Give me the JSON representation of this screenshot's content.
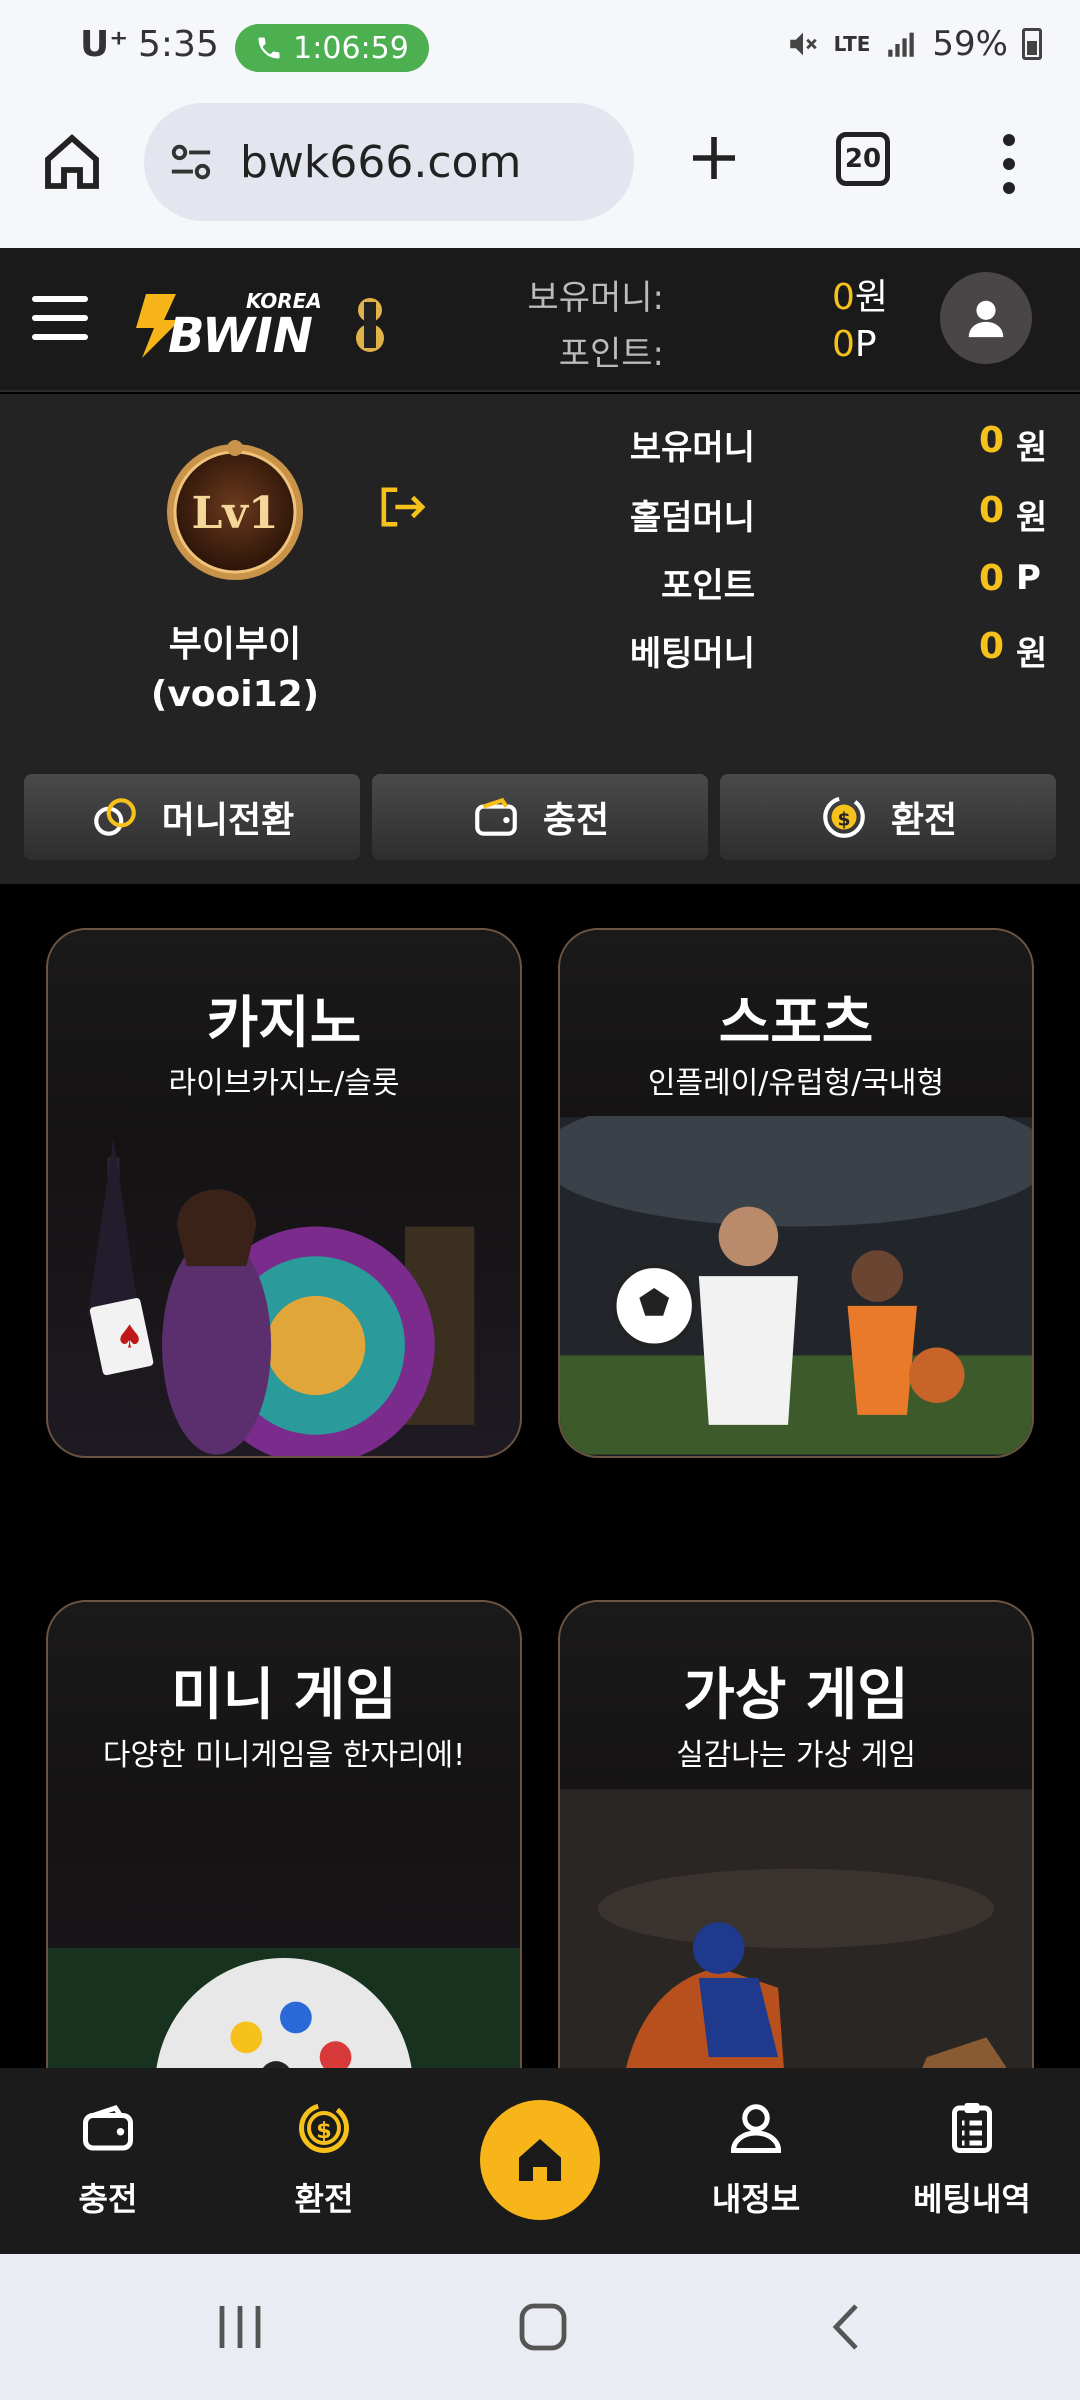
{
  "status_bar": {
    "carrier": "U⁺",
    "time": "5:35",
    "call_duration": "1:06:59",
    "network": "LTE",
    "battery": "59%"
  },
  "browser": {
    "url": "bwk666.com",
    "tab_count": "20"
  },
  "header": {
    "logo_small": "KOREA",
    "logo_main": "BWIN",
    "money_label": "보유머니:",
    "money_value": "0",
    "money_unit": "원",
    "point_label": "포인트:",
    "point_value": "0",
    "point_unit": "P"
  },
  "account": {
    "level": "Lv1",
    "nickname": "부이부이",
    "user_id": "(vooi12)",
    "balances": [
      {
        "label": "보유머니",
        "value": "0",
        "unit": "원"
      },
      {
        "label": "홀덤머니",
        "value": "0",
        "unit": "원"
      },
      {
        "label": "포인트",
        "value": "0",
        "unit": "P"
      },
      {
        "label": "베팅머니",
        "value": "0",
        "unit": "원"
      }
    ],
    "actions": [
      {
        "label": "머니전환"
      },
      {
        "label": "충전"
      },
      {
        "label": "환전"
      }
    ]
  },
  "games": [
    {
      "title": "카지노",
      "subtitle": "라이브카지노/슬롯"
    },
    {
      "title": "스포츠",
      "subtitle": "인플레이/유럽형/국내형"
    },
    {
      "title": "미니 게임",
      "subtitle": "다양한 미니게임을 한자리에!"
    },
    {
      "title": "가상 게임",
      "subtitle": "실감나는 가상 게임"
    }
  ],
  "bottom_nav": [
    {
      "label": "충전"
    },
    {
      "label": "환전"
    },
    {
      "label": "내정보"
    },
    {
      "label": "베팅내역"
    }
  ],
  "colors": {
    "accent_gold": "#f5c11a",
    "home_button": "#f7b51a",
    "call_pill": "#4caf50"
  }
}
